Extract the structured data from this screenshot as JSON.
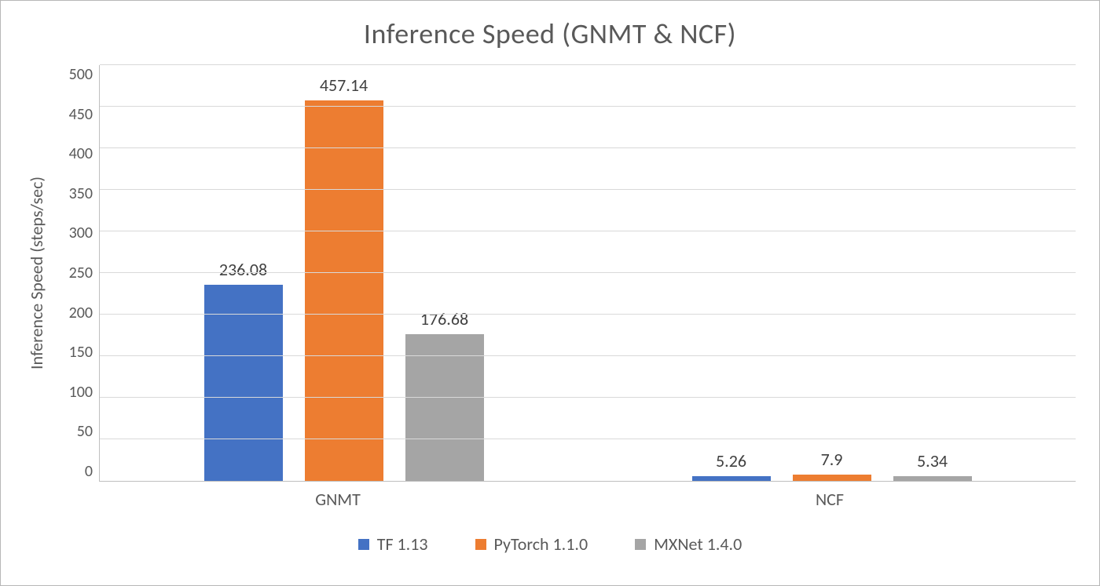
{
  "chart_data": {
    "type": "bar",
    "title": "Inference Speed (GNMT & NCF)",
    "xlabel": "",
    "ylabel": "Inference Speed (steps/sec)",
    "categories": [
      "GNMT",
      "NCF"
    ],
    "series": [
      {
        "name": "TF 1.13",
        "color": "#4472c4",
        "values": [
          236.08,
          5.26
        ]
      },
      {
        "name": "PyTorch 1.1.0",
        "color": "#ed7d31",
        "values": [
          457.14,
          7.9
        ]
      },
      {
        "name": "MXNet 1.4.0",
        "color": "#a5a5a5",
        "values": [
          176.68,
          5.34
        ]
      }
    ],
    "ylim": [
      0,
      500
    ],
    "yticks": [
      0,
      50,
      100,
      150,
      200,
      250,
      300,
      350,
      400,
      450,
      500
    ],
    "grid": true,
    "legend_position": "bottom"
  }
}
